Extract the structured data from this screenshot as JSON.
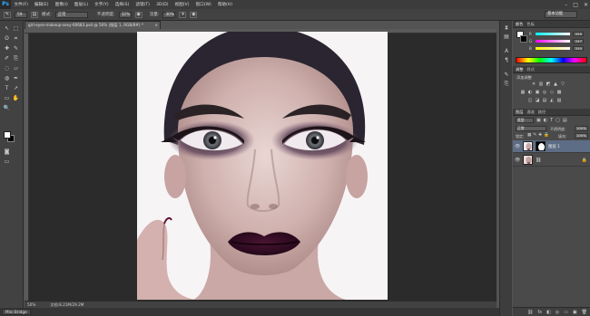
{
  "app": {
    "logo": "Ps"
  },
  "menu": [
    "文件(F)",
    "编辑(E)",
    "图像(I)",
    "图层(L)",
    "文字(Y)",
    "选择(S)",
    "滤镜(T)",
    "3D(D)",
    "视图(V)",
    "窗口(W)",
    "帮助(H)"
  ],
  "window_controls": {
    "minimize": "–",
    "maximize": "□",
    "close": "✕"
  },
  "options": {
    "brush_size": "59",
    "mode_label": "模式:",
    "mode_value": "正常",
    "opacity_label": "不透明度:",
    "opacity_value": "32%",
    "flow_label": "流量:",
    "flow_value": "30%"
  },
  "workspace": "基本功能",
  "document": {
    "tab_title": "girl-eyes-makeup-sexy-60683.psd @ 50% (图层 1, RGB/8#) *",
    "tab_close": "×",
    "zoom": "50%",
    "doc_size": "文档:8.21M/29.2M"
  },
  "bottom_tab": "Mini Bridge",
  "color_panel": {
    "tabs": [
      "颜色",
      "色板"
    ],
    "channels": [
      {
        "letter": "R",
        "value": "255",
        "color": "#ff6a6a"
      },
      {
        "letter": "G",
        "value": "247",
        "color": "#6aff6a"
      },
      {
        "letter": "B",
        "value": "255",
        "color": "#6a6aff"
      }
    ]
  },
  "adjust_panel": {
    "tabs": [
      "调整",
      "样式"
    ],
    "title": "添加调整",
    "icons_row1": [
      "☀",
      "▥",
      "◩",
      "▲",
      "▽"
    ],
    "icons_row2": [
      "▦",
      "◐",
      "▣",
      "◎",
      "◇",
      "▩"
    ],
    "icons_row3": [
      "◫",
      "◪",
      "▤",
      "◭",
      "▧"
    ]
  },
  "layers_panel": {
    "tabs": [
      "图层",
      "通道",
      "路径"
    ],
    "kind_label": "类型",
    "blend_mode": "正常",
    "opacity_label": "不透明度:",
    "opacity_value": "100%",
    "lock_label": "锁定:",
    "fill_label": "填充:",
    "fill_value": "100%",
    "layers": [
      {
        "name": "图层 1",
        "selected": true
      },
      {
        "name": "",
        "selected": false
      }
    ],
    "bottom_icons": [
      "⛓",
      "fx",
      "◧",
      "◎",
      "▭",
      "▣",
      "🗑"
    ]
  },
  "tools": [
    "↖",
    "⬚",
    "ʘ",
    "⌗",
    "✚",
    "✎",
    "✐",
    "⎘",
    "◌",
    "▱",
    "◍",
    "✒",
    "T",
    "↗",
    "▭",
    "✋",
    "🔍"
  ]
}
